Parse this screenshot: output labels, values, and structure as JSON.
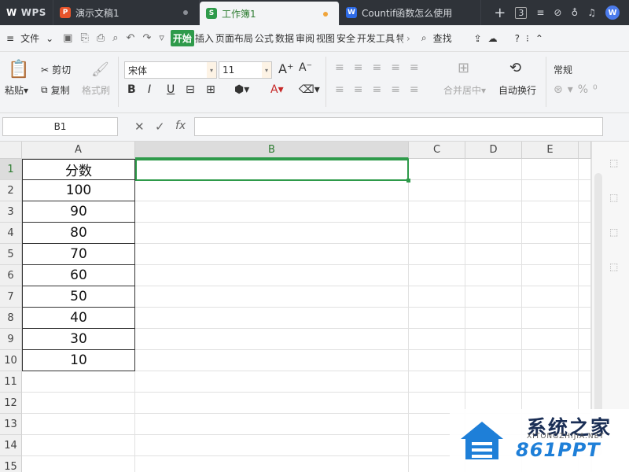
{
  "tabs": {
    "wps": "WPS",
    "t1": "演示文稿1",
    "t2": "工作簿1",
    "t3": "Countif函数怎么使用",
    "count": "3"
  },
  "menu": {
    "file": "文件",
    "items": [
      "开始",
      "插入",
      "页面布局",
      "公式",
      "数据",
      "审阅",
      "视图",
      "安全",
      "开发工具",
      "特色"
    ],
    "search": "查找"
  },
  "ribbon": {
    "paste": "粘贴",
    "cut": "剪切",
    "copy": "复制",
    "format_painter": "格式刷",
    "font_name": "宋体",
    "font_size": "11",
    "merge": "合并居中",
    "wrap": "自动换行",
    "number_format": "常规"
  },
  "formula": {
    "name_box": "B1",
    "fx": "fx",
    "value": ""
  },
  "grid": {
    "columns": [
      "A",
      "B",
      "C",
      "D",
      "E"
    ],
    "rows": [
      "1",
      "2",
      "3",
      "4",
      "5",
      "6",
      "7",
      "8",
      "9",
      "10",
      "11",
      "12",
      "13",
      "14",
      "15"
    ],
    "colA": [
      "分数",
      "100",
      "90",
      "80",
      "70",
      "60",
      "50",
      "40",
      "30",
      "10"
    ]
  },
  "watermark": {
    "cn": "系统之家",
    "en": "XITONGZHIJIA.NET",
    "brand": "861PPT"
  },
  "colors": {
    "accent": "#2e9a4a",
    "tabbar": "#2f3339"
  }
}
